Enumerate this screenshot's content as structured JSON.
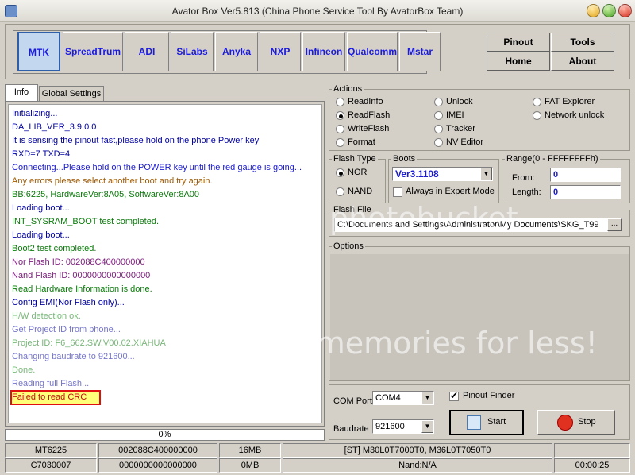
{
  "window": {
    "title": "Avator Box Ver5.813 (China Phone Service Tool By AvatorBox Team)"
  },
  "vendors": [
    "MTK",
    "SpreadTrum",
    "ADI",
    "SiLabs",
    "Anyka",
    "NXP",
    "Infineon",
    "Qualcomm",
    "Mstar"
  ],
  "vendor_active": "MTK",
  "nav": {
    "pinout": "Pinout",
    "tools": "Tools",
    "home": "Home",
    "about": "About"
  },
  "tabs": {
    "info": "Info",
    "global_settings": "Global Settings"
  },
  "log": [
    {
      "text": "Initializing...",
      "color": "navy"
    },
    {
      "text": "DA_LIB_VER_3.9.0.0",
      "color": "navy"
    },
    {
      "text": "It is sensing the pinout fast,please hold on the phone Power key",
      "color": "navy"
    },
    {
      "text": "RXD=7  TXD=4",
      "color": "navy"
    },
    {
      "text": "Connecting...Please hold on the POWER key until the red gauge is going...",
      "color": "blue"
    },
    {
      "text": "Any errors please select another boot and try again.",
      "color": "olive"
    },
    {
      "text": "BB:6225,     HardwareVer:8A05,     SoftwareVer:8A00",
      "color": "green"
    },
    {
      "text": "Loading boot...",
      "color": "navy"
    },
    {
      "text": "INT_SYSRAM_BOOT test completed.",
      "color": "green"
    },
    {
      "text": "Loading boot...",
      "color": "navy"
    },
    {
      "text": "Boot2 test completed.",
      "color": "green"
    },
    {
      "text": "Nor Flash ID: 002088C400000000",
      "color": "purple"
    },
    {
      "text": "Nand Flash ID: 0000000000000000",
      "color": "purple"
    },
    {
      "text": "Read Hardware Information is done.",
      "color": "green"
    },
    {
      "text": "Config EMI(Nor Flash only)...",
      "color": "navy"
    },
    {
      "text": "H/W detection ok.",
      "color": "green"
    },
    {
      "text": "Get Project ID from phone...",
      "color": "navy"
    },
    {
      "text": "Project ID: F6_662.SW.V00.02.XIAHUA",
      "color": "green"
    },
    {
      "text": "Changing baudrate to 921600...",
      "color": "navy"
    },
    {
      "text": "Done.",
      "color": "green"
    },
    {
      "text": "Reading full Flash...",
      "color": "navy"
    },
    {
      "text": "Failed to read CRC",
      "color": "red"
    }
  ],
  "progress": {
    "text": "0%",
    "value": 0
  },
  "actions": {
    "label": "Actions",
    "options": [
      "ReadInfo",
      "Unlock",
      "FAT Explorer",
      "ReadFlash",
      "IMEI",
      "Network unlock",
      "WriteFlash",
      "Tracker",
      "Format",
      "NV Editor"
    ],
    "selected": "ReadFlash"
  },
  "flash_type": {
    "label": "Flash Type",
    "options": [
      "NOR",
      "NAND"
    ],
    "selected": "NOR"
  },
  "boots": {
    "label": "Boots",
    "value": "Ver3.1108",
    "expert_mode_label": "Always in Expert Mode",
    "expert_mode": false
  },
  "range": {
    "label": "Range(0 - FFFFFFFFh)",
    "from_label": "From:",
    "from_value": "0",
    "length_label": "Length:",
    "length_value": "0"
  },
  "flash_file": {
    "label": "Flash File",
    "value": "C:\\Documents and Settings\\Administrator\\My Documents\\SKG_T99",
    "browse": "..."
  },
  "options": {
    "label": "Options"
  },
  "com": {
    "port_label": "COM Port",
    "port_value": "COM4",
    "baud_label": "Baudrate",
    "baud_value": "921600",
    "pinout_finder_label": "Pinout Finder",
    "pinout_finder": true
  },
  "buttons": {
    "start": "Start",
    "stop": "Stop"
  },
  "status_bar": {
    "row1": [
      "MT6225",
      "002088C400000000",
      "16MB",
      "[ST] M30L0T7000T0, M36L0T7050T0",
      ""
    ],
    "row2": [
      "C7030007",
      "0000000000000000",
      "0MB",
      "Nand:N/A",
      "00:00:25"
    ]
  },
  "colors": {
    "navy": "#0000a0",
    "blue": "#1a1ad0",
    "green": "#0a7a0a",
    "red": "#c01010",
    "olive": "#a05a00",
    "purple": "#7a1a7a",
    "highlight": "#ffff7a"
  },
  "watermark": {
    "line1": "photobucket",
    "line2": "r memories for less!"
  }
}
